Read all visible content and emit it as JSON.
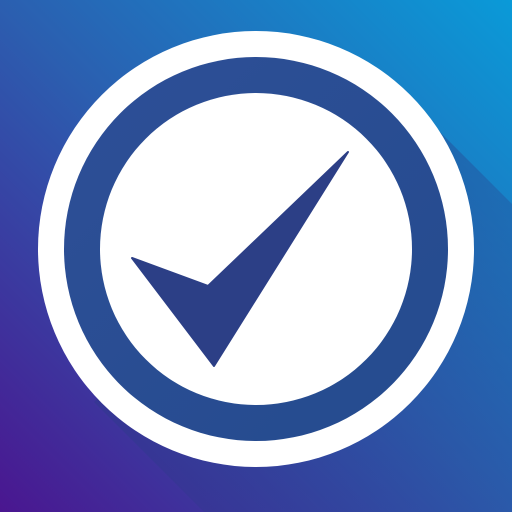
{
  "icon": {
    "name": "checkmark-circle-icon",
    "colors": {
      "background_top_right": "#0a9ad8",
      "background_mid": "#2b5fb0",
      "background_bottom_left": "#4a1690",
      "long_shadow": "#2a3a86",
      "ring_outer": "#ffffff",
      "ring_band_start": "#2e4f97",
      "ring_band_end": "#244b8e",
      "inner_disc": "#ffffff",
      "checkmark": "#2c3f86"
    }
  }
}
